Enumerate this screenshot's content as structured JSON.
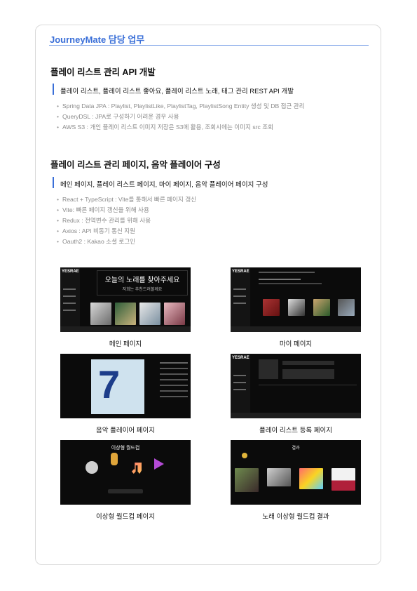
{
  "header": {
    "title": "JourneyMate 담당 업무"
  },
  "sections": [
    {
      "title": "플레이 리스트 관리 API 개발",
      "subtitle": "플레이 리스트, 플레이 리스트 좋아요, 플레이 리스트 노래, 태그 관리  REST API 개발",
      "bullets": [
        "Spring Data JPA : Playlist, PlaylistLike, PlaylistTag, PlaylistSong Entity 생성 및 DB 접근 관리",
        "QueryDSL : JPA로 구성하기 어려운 경우 사용",
        "AWS S3 : 개인 플레이 리스트 이미지 저장은 S3에 활용, 조회시에는 이미지 src 조회"
      ]
    },
    {
      "title": "플레이 리스트 관리 페이지, 음악 플레이어 구성",
      "subtitle": "메인 페이지, 플레이 리스트 페이지, 마이 페이지, 음악 플레이어 페이지 구성",
      "bullets": [
        "React + TypeScript :  Vite를 통해서 빠른 페이지 갱신",
        "Vite: 빠른 페이지 갱신을 위해 사용",
        "Redux : 전역변수 관리를 위해 사용",
        "Axios : API 비동기 통신 지원",
        "Oauth2 : Kakao 소셜 로그인"
      ]
    }
  ],
  "screens": {
    "logo": "YESRAE",
    "main_banner_line1": "오늘의 노래를 찾아주세요",
    "main_banner_line2": "저희는 추천드려볼께요",
    "worldcup_title": "이상형 월드컵",
    "result_title": "결과",
    "album_text": "7",
    "captions": [
      "메인 페이지",
      "마이 페이지",
      "음악 플레이어 페이지",
      "플레이 리스트 등록 페이지",
      "이상형 월드컵 페이지",
      "노래 이상형 월드컵 결과"
    ]
  },
  "colors": {
    "accent": "#3a6fd8",
    "rule": "#7aa0e8",
    "bullet_text": "#8a8a8a",
    "screen_bg": "#0b0b0b"
  }
}
